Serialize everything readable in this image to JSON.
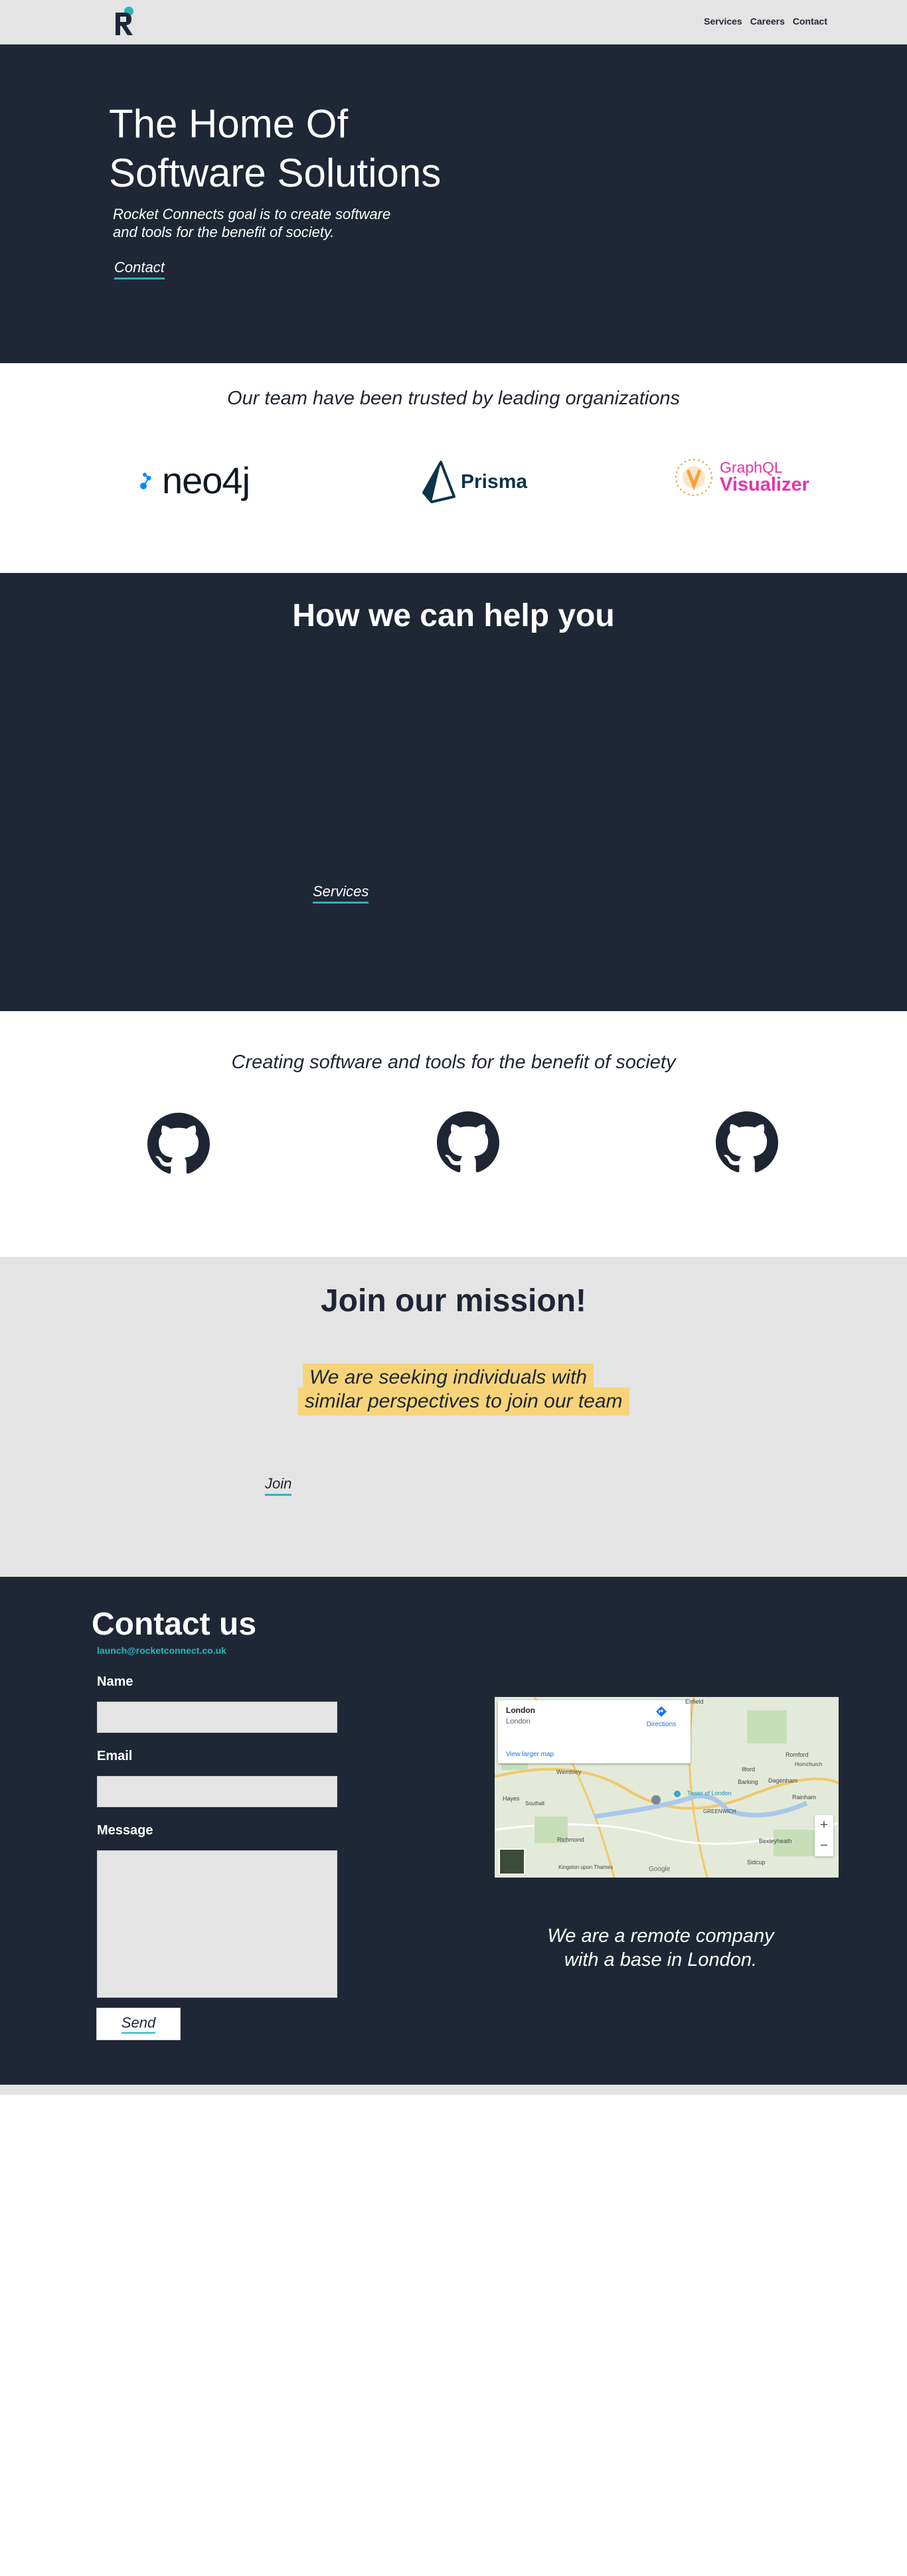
{
  "header": {
    "logo_letter": "R",
    "nav": [
      "Services",
      "Careers",
      "Contact"
    ]
  },
  "hero": {
    "title_line1": "The Home Of",
    "title_line2": "Software Solutions",
    "subtitle_line1": "Rocket Connects goal is to create software",
    "subtitle_line2": "and tools for the benefit of society.",
    "cta": "Contact"
  },
  "trusted": {
    "title": "Our team have been trusted by leading organizations",
    "brands": [
      {
        "name": "neo4j"
      },
      {
        "name": "Prisma"
      },
      {
        "name_line1": "GraphQL",
        "name_line2": "Visualizer"
      }
    ]
  },
  "help": {
    "title": "How we can help you",
    "cta": "Services"
  },
  "creating": {
    "title": "Creating software and tools for the benefit of society"
  },
  "join": {
    "title": "Join our mission!",
    "highlight_line1": "We are seeking individuals with",
    "highlight_line2": "similar perspectives to join our team",
    "cta": "Join"
  },
  "contact": {
    "title": "Contact us",
    "email": "launch@rocketconnect.co.uk",
    "fields": {
      "name": "Name",
      "email": "Email",
      "message": "Message"
    },
    "send": "Send",
    "remote_line1": "We are a remote company",
    "remote_line2": "with a base in London.",
    "map": {
      "place": "London",
      "place_sub": "London",
      "directions": "Directions",
      "larger_map": "View larger map",
      "labels": [
        "Enfield",
        "Romford",
        "Ilford",
        "Hornchurch",
        "Wembley",
        "Barking",
        "Dagenham",
        "Hayes",
        "Southall",
        "Tower of London",
        "Rainham",
        "GREENWICH",
        "Richmond",
        "Bexleyheath",
        "Sidcup",
        "Kingston upon Thames",
        "Google"
      ]
    }
  },
  "colors": {
    "dark": "#1f2736",
    "light_gray": "#e4e4e4",
    "accent": "#26b7ba",
    "highlight": "#f7d47a"
  }
}
